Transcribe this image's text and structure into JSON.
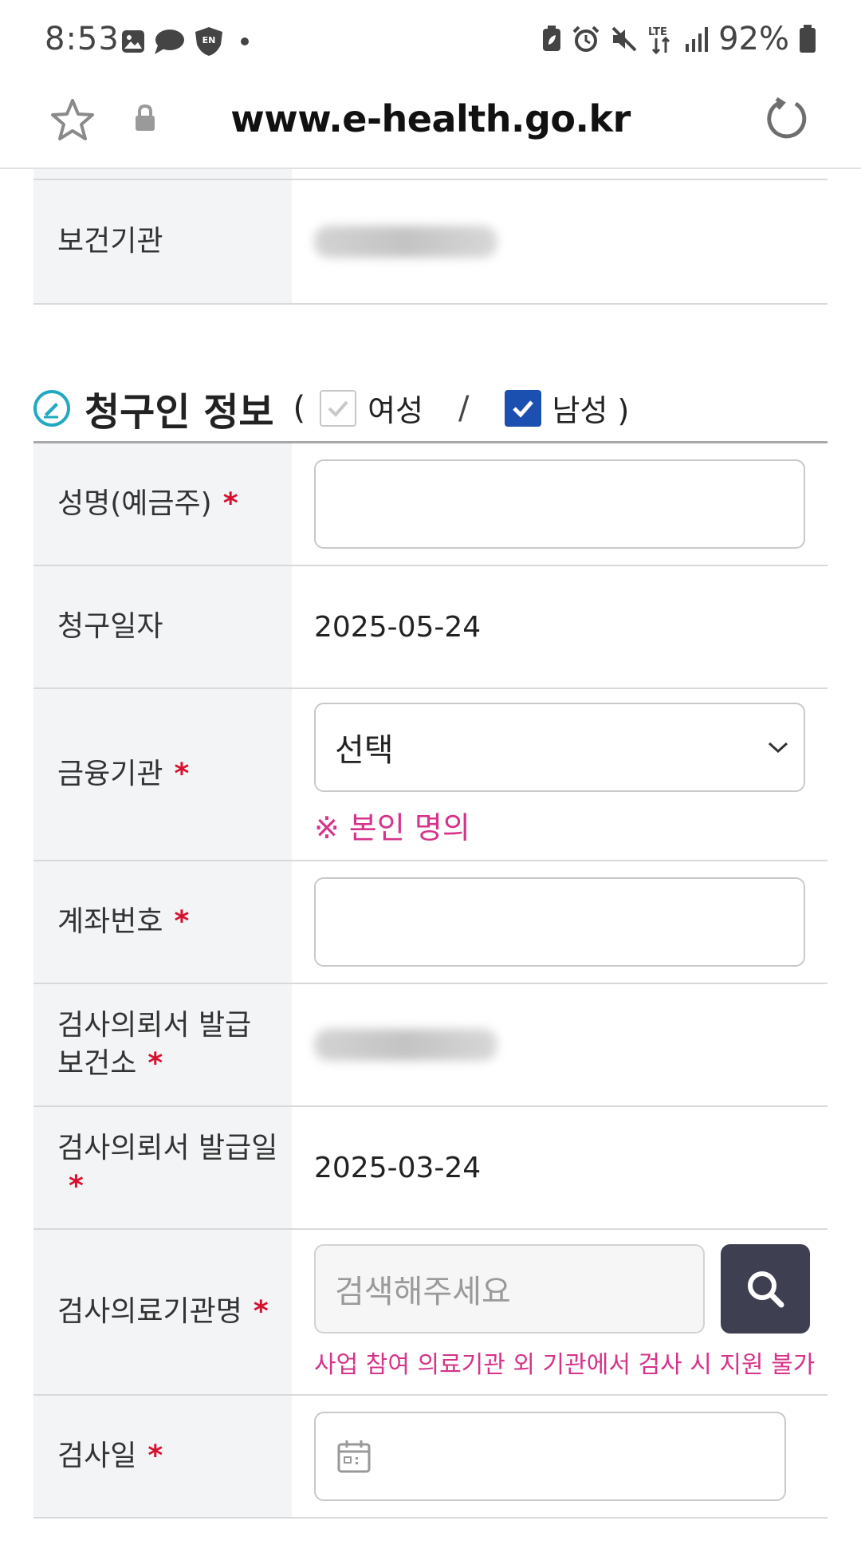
{
  "status_bar": {
    "time": "8:53",
    "battery": "92%",
    "left_icons": [
      "gallery-icon",
      "chat-icon",
      "vpn-shield-icon",
      "dot-icon"
    ],
    "right_icons": [
      "battery-saver-icon",
      "alarm-icon",
      "mute-icon",
      "lte-icon",
      "signal-icon",
      "battery-icon"
    ]
  },
  "browser": {
    "url": "www.e-health.go.kr"
  },
  "top_row": {
    "label": "보건기관"
  },
  "section": {
    "title": "청구인 정보",
    "open_paren": "(",
    "female_label": "여성",
    "female_checked": false,
    "slash": "/",
    "male_label": "남성 )",
    "male_checked": true
  },
  "rows": {
    "name": {
      "label": "성명(예금주)",
      "required": "*"
    },
    "claim_date": {
      "label": "청구일자",
      "value": "2025-05-24"
    },
    "bank": {
      "label": "금융기관",
      "required": "*",
      "selected": "선택",
      "note": "※ 본인 명의"
    },
    "account": {
      "label": "계좌번호",
      "required": "*"
    },
    "issuing_center": {
      "label_line1": "검사의뢰서 발급",
      "label_line2": "보건소",
      "required": "*"
    },
    "issue_date": {
      "label": "검사의뢰서 발급일",
      "required": "*",
      "value": "2025-03-24"
    },
    "hospital": {
      "label": "검사의료기관명",
      "required": "*",
      "placeholder": "검색해주세요",
      "note": "사업 참여 의료기관 외 기관에서 검사 시 지원 불가"
    },
    "exam_date": {
      "label": "검사일",
      "required": "*"
    }
  },
  "colors": {
    "accent_blue": "#1b4fb0",
    "required_red": "#d6102d",
    "note_pink": "#d6338a",
    "search_button": "#3f3f52",
    "label_bg": "#f3f4f6"
  }
}
